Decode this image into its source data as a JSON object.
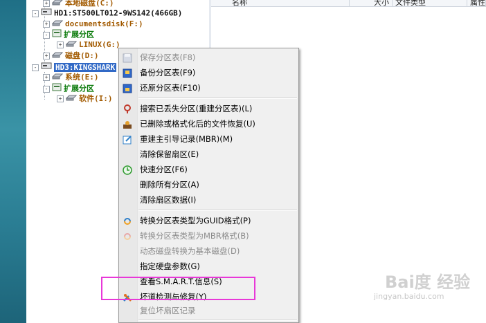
{
  "colors": {
    "selection": "#3169c6",
    "highlight_box": "#e838d8",
    "partition_text": "#a25a00",
    "extended_text": "#0a7a0a"
  },
  "list_header": {
    "name": "名称",
    "size": "大小",
    "filetype": "文件类型",
    "attr": "属性"
  },
  "tree": [
    {
      "toggle": "+",
      "icon": "drive-icon",
      "label": "本地磁盘(C:)"
    },
    {
      "toggle": "-",
      "icon": "harddisk-icon",
      "label": "HD1:ST500LT012-9WS142(466GB)"
    },
    {
      "toggle": "+",
      "icon": "drive-icon",
      "label": "documentsdisk(F:)"
    },
    {
      "toggle": "-",
      "icon": "extended-icon",
      "label": "扩展分区"
    },
    {
      "toggle": "+",
      "icon": "drive-icon",
      "label": "LINUX(G:)"
    },
    {
      "toggle": "+",
      "icon": "drive-icon",
      "label": "磁盘(D:)"
    },
    {
      "toggle": "-",
      "icon": "harddisk-icon",
      "label": "HD3:KINGSHARK"
    },
    {
      "toggle": "+",
      "icon": "drive-icon",
      "label": "系统(E:)"
    },
    {
      "toggle": "-",
      "icon": "extended-icon",
      "label": "扩展分区"
    },
    {
      "toggle": "+",
      "icon": "drive-icon",
      "label": "软件(I:)"
    }
  ],
  "menu": {
    "items": [
      {
        "label": "保存分区表(F8)",
        "icon": "save-icon",
        "disabled": true
      },
      {
        "label": "备份分区表(F9)",
        "icon": "backup-icon",
        "disabled": false
      },
      {
        "label": "还原分区表(F10)",
        "icon": "restore-icon",
        "disabled": false
      },
      {
        "label": "搜索已丢失分区(重建分区表)(L)",
        "icon": "search-icon",
        "disabled": false
      },
      {
        "label": "已删除或格式化后的文件恢复(U)",
        "icon": "recover-icon",
        "disabled": false
      },
      {
        "label": "重建主引导记录(MBR)(M)",
        "icon": "mbr-icon",
        "disabled": false
      },
      {
        "label": "清除保留扇区(E)",
        "icon": "",
        "disabled": false
      },
      {
        "label": "快速分区(F6)",
        "icon": "clock-icon",
        "disabled": false
      },
      {
        "label": "删除所有分区(A)",
        "icon": "",
        "disabled": false
      },
      {
        "label": "清除扇区数据(I)",
        "icon": "",
        "disabled": false
      },
      {
        "label": "转换分区表类型为GUID格式(P)",
        "icon": "convert-icon",
        "disabled": false
      },
      {
        "label": "转换分区表类型为MBR格式(B)",
        "icon": "convert-mbr-icon",
        "disabled": true
      },
      {
        "label": "动态磁盘转换为基本磁盘(D)",
        "icon": "",
        "disabled": true
      },
      {
        "label": "指定硬盘参数(G)",
        "icon": "",
        "disabled": false
      },
      {
        "label": "查看S.M.A.R.T.信息(S)",
        "icon": "",
        "disabled": false
      },
      {
        "label": "坏道检测与修复(Y)",
        "icon": "tools-icon",
        "disabled": false
      },
      {
        "label": "复位坏扇区记录",
        "icon": "",
        "disabled": true
      }
    ]
  },
  "watermark": {
    "brand": "Bai度 经验",
    "url": "jingyan.baidu.com"
  }
}
